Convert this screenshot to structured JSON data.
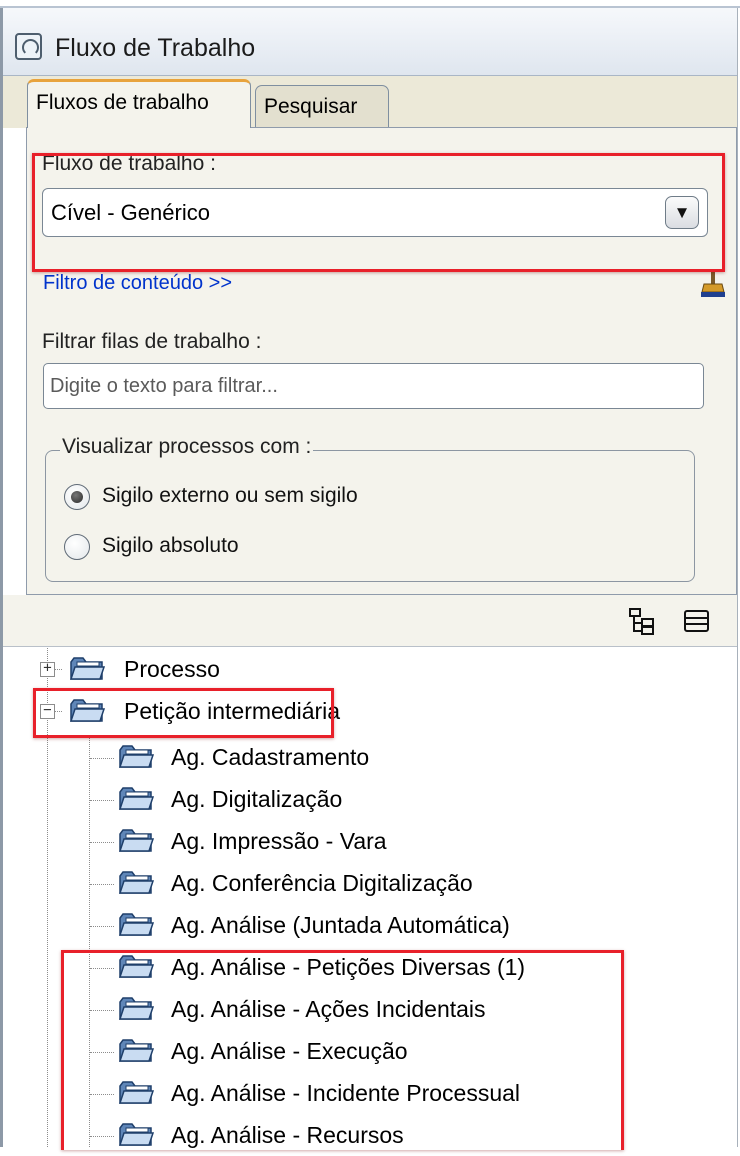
{
  "window": {
    "title": "Fluxo de Trabalho"
  },
  "tabs": [
    {
      "label": "Fluxos de trabalho",
      "active": true
    },
    {
      "label": "Pesquisar",
      "active": false
    }
  ],
  "form": {
    "workflow_label": "Fluxo de trabalho :",
    "workflow_value": "Cível - Genérico",
    "content_filter_link": "Filtro de conteúdo >>",
    "queue_filter_label": "Filtrar filas de trabalho :",
    "queue_filter_placeholder": "Digite o texto para filtrar...",
    "view_group_legend": "Visualizar processos com :",
    "radios": [
      {
        "label": "Sigilo externo ou sem sigilo",
        "checked": true
      },
      {
        "label": "Sigilo absoluto",
        "checked": false
      }
    ]
  },
  "tree": {
    "roots": [
      {
        "label": "Processo",
        "expanded": false
      },
      {
        "label": "Petição intermediária",
        "expanded": true
      }
    ],
    "children": [
      "Ag. Cadastramento",
      "Ag. Digitalização",
      "Ag. Impressão - Vara",
      "Ag. Conferência Digitalização",
      "Ag. Análise (Juntada Automática)",
      "Ag. Análise - Petições Diversas (1)",
      "Ag. Análise - Ações Incidentais",
      "Ag. Análise - Execução",
      "Ag. Análise - Incidente Processual",
      "Ag. Análise - Recursos"
    ]
  },
  "colors": {
    "highlight": "#e8202a",
    "link": "#0033cc",
    "panel_bg": "#f4f3ec",
    "tab_accent": "#e8a33d"
  },
  "icons": {
    "app": "window-app-icon",
    "clear_filter": "broom-icon",
    "tree_view": "tree-view-icon",
    "collapse_all": "collapse-all-icon",
    "node": "folder-icon"
  }
}
